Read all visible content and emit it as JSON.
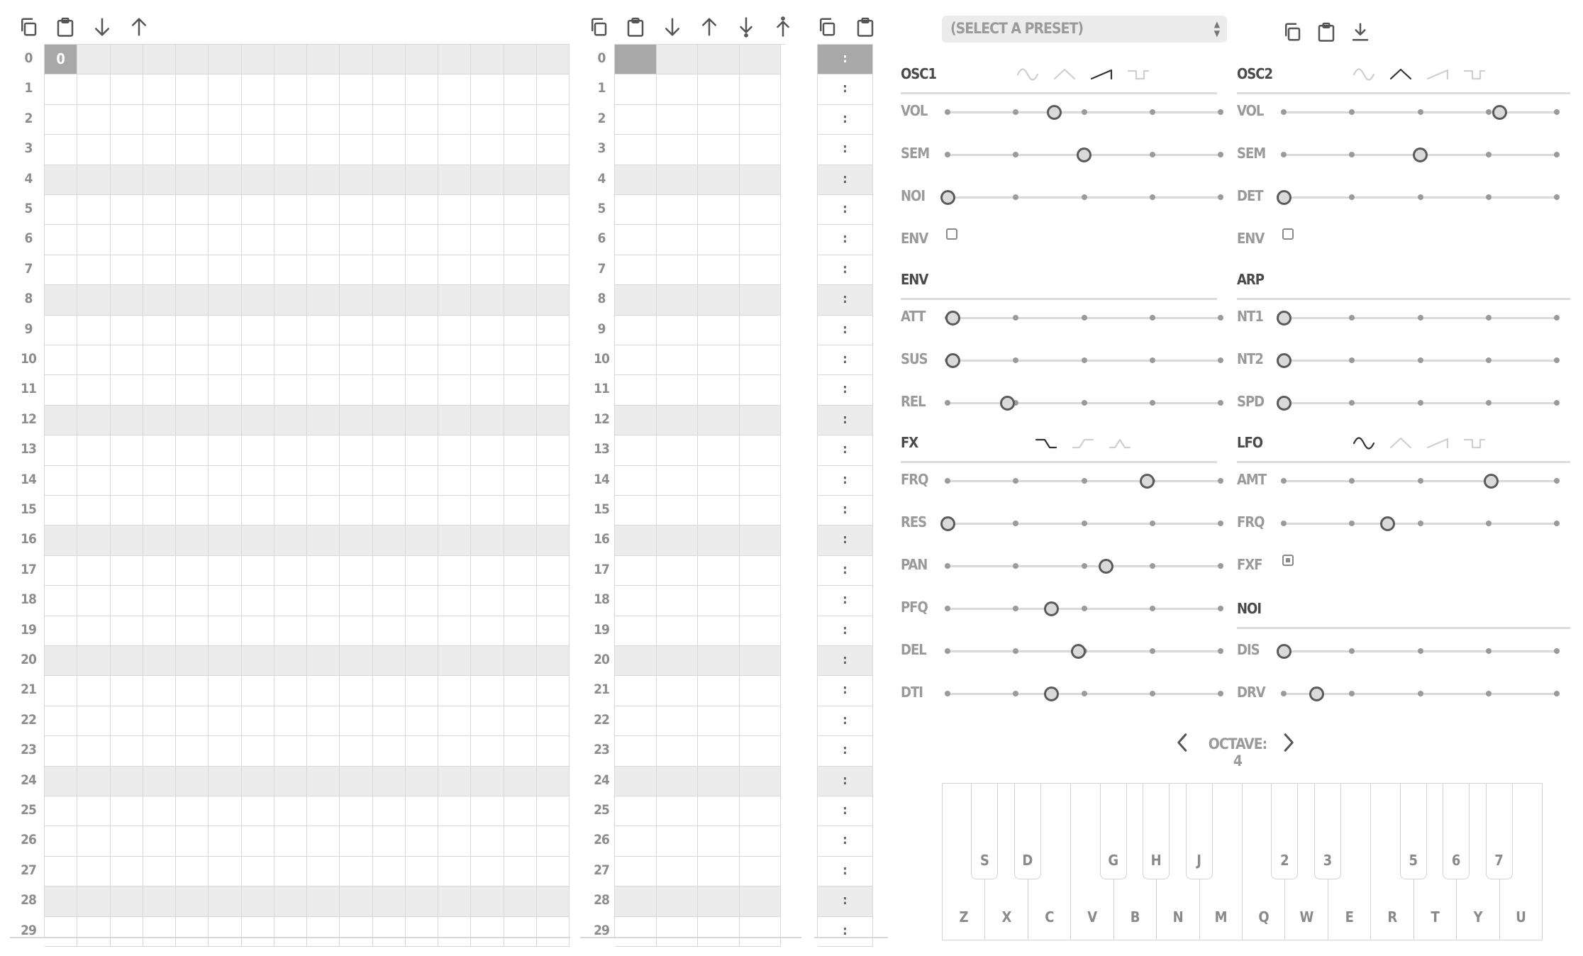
{
  "rows": [
    "0",
    "1",
    "2",
    "3",
    "4",
    "5",
    "6",
    "7",
    "8",
    "9",
    "10",
    "11",
    "12",
    "13",
    "14",
    "15",
    "16",
    "17",
    "18",
    "19",
    "20",
    "21",
    "22",
    "23",
    "24",
    "25",
    "26",
    "27",
    "28",
    "29"
  ],
  "pattern": {
    "first_cell_value": "0",
    "toolbar": [
      "copy-icon",
      "paste-icon",
      "arrow-down-icon",
      "arrow-up-icon"
    ]
  },
  "sequence": {
    "toolbar": [
      "copy-icon",
      "paste-icon",
      "arrow-down-icon",
      "arrow-up-icon",
      "insert-down-icon",
      "insert-up-icon"
    ]
  },
  "song": {
    "toolbar": [
      "copy-icon",
      "paste-icon"
    ],
    "row_marker": ":"
  },
  "preset": {
    "placeholder": "(SELECT A PRESET)",
    "toolbar": [
      "copy-icon",
      "paste-icon",
      "download-icon"
    ]
  },
  "sections": {
    "osc1": "OSC1",
    "osc2": "OSC2",
    "env": "ENV",
    "arp": "ARP",
    "fx": "FX",
    "lfo": "LFO",
    "noi": "NOI"
  },
  "params": {
    "osc1": {
      "vol": "VOL",
      "sem": "SEM",
      "noi": "NOI",
      "env": "ENV"
    },
    "osc2": {
      "vol": "VOL",
      "sem": "SEM",
      "det": "DET",
      "env": "ENV"
    },
    "env": {
      "att": "ATT",
      "sus": "SUS",
      "rel": "REL"
    },
    "arp": {
      "nt1": "NT1",
      "nt2": "NT2",
      "spd": "SPD"
    },
    "fx": {
      "frq": "FRQ",
      "res": "RES",
      "pan": "PAN",
      "pfq": "PFQ",
      "del": "DEL",
      "dti": "DTI"
    },
    "lfo": {
      "amt": "AMT",
      "frq": "FRQ",
      "fxf": "FXF"
    },
    "noi": {
      "dis": "DIS",
      "drv": "DRV"
    }
  },
  "slider_values": {
    "osc1_vol": 0.39,
    "osc1_sem": 0.5,
    "osc1_noi": 0.0,
    "osc2_vol": 0.79,
    "osc2_sem": 0.5,
    "osc2_det": 0.0,
    "env_att": 0.02,
    "env_sus": 0.02,
    "env_rel": 0.22,
    "arp_nt1": 0.0,
    "arp_nt2": 0.0,
    "arp_spd": 0.0,
    "fx_frq": 0.73,
    "fx_res": 0.0,
    "fx_pan": 0.58,
    "fx_pfq": 0.38,
    "fx_del": 0.48,
    "fx_dti": 0.38,
    "lfo_amt": 0.76,
    "lfo_frq": 0.38,
    "noi_dis": 0.0,
    "noi_drv": 0.12
  },
  "checkboxes": {
    "osc1_env": false,
    "osc2_env": false,
    "lfo_fxf": true
  },
  "waveforms": {
    "osc1": {
      "options": [
        "sine",
        "triangle",
        "sawtooth",
        "square"
      ],
      "selected": "sawtooth"
    },
    "osc2": {
      "options": [
        "sine",
        "triangle",
        "sawtooth",
        "square"
      ],
      "selected": "triangle"
    },
    "fx": {
      "options": [
        "lowpass",
        "highpass",
        "bandpass"
      ],
      "selected": "lowpass"
    },
    "lfo": {
      "options": [
        "sine",
        "triangle",
        "sawtooth",
        "square"
      ],
      "selected": "sine"
    }
  },
  "octave": {
    "label": "OCTAVE: 4"
  },
  "keyboard": {
    "white_keys": [
      "Z",
      "X",
      "C",
      "V",
      "B",
      "N",
      "M",
      "Q",
      "W",
      "E",
      "R",
      "T",
      "Y",
      "U"
    ],
    "black_keys": [
      "S",
      "D",
      "G",
      "H",
      "J",
      "2",
      "3",
      "5",
      "6",
      "7"
    ]
  },
  "colors": {
    "accent": "#4a4a4a",
    "grid": "#d8d8d8",
    "highlight_row": "#ececec",
    "selected_cell": "#a8a8a8"
  }
}
